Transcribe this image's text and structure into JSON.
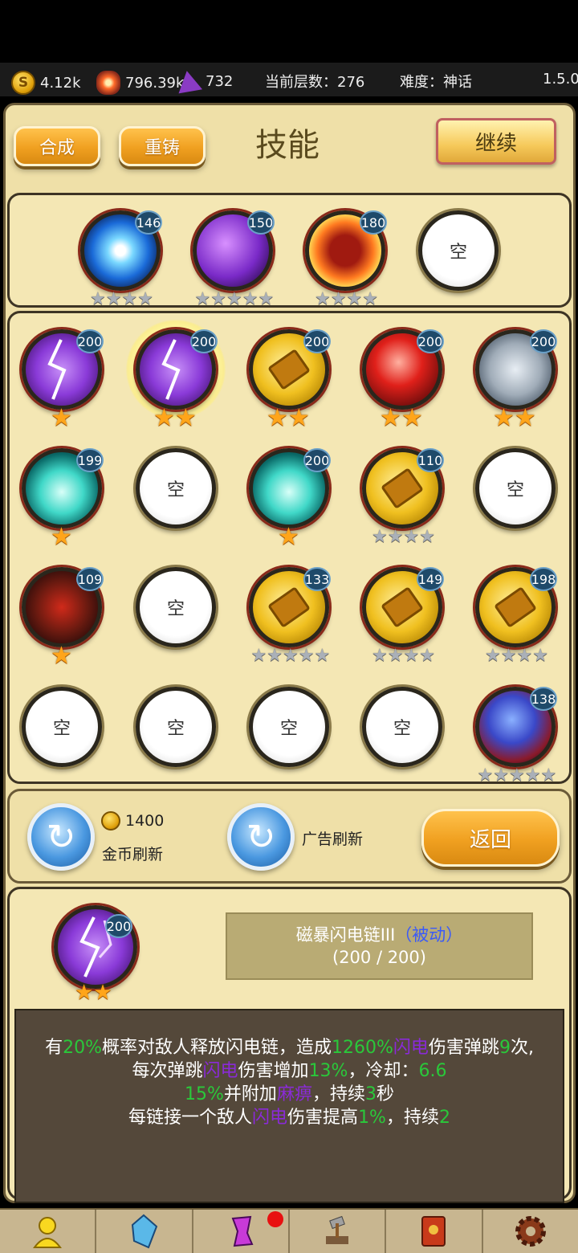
{
  "topbar": {
    "gold": "4.12k",
    "ore": "796.39k",
    "gems": "732",
    "floor": "当前层数：276",
    "difficulty": "难度：神话",
    "version": "1.5.0"
  },
  "header": {
    "craft_label": "合成",
    "reforge_label": "重铸",
    "title": "技能",
    "continue_label": "继续"
  },
  "equipped": [
    {
      "level": "146",
      "stars": 4,
      "skill": "lightning-orb"
    },
    {
      "level": "150",
      "stars": 5,
      "skill": "arcane-bolt"
    },
    {
      "level": "180",
      "stars": 4,
      "skill": "fire-body"
    },
    {
      "empty": "空"
    }
  ],
  "inventory": [
    {
      "level": "200",
      "stars": 1,
      "star_type": "orange",
      "skill": "chain-lightning"
    },
    {
      "level": "200",
      "stars": 2,
      "star_type": "orange",
      "skill": "chain-lightning",
      "selected": true
    },
    {
      "level": "200",
      "stars": 2,
      "star_type": "orange",
      "skill": "gold-brick"
    },
    {
      "level": "200",
      "stars": 2,
      "star_type": "orange",
      "skill": "blood-drop"
    },
    {
      "level": "200",
      "stars": 2,
      "star_type": "orange",
      "skill": "stone-skin"
    },
    {
      "level": "199",
      "stars": 1,
      "star_type": "orange",
      "skill": "ice-spikes"
    },
    {
      "empty": "空"
    },
    {
      "level": "200",
      "stars": 1,
      "star_type": "orange",
      "skill": "ice-spikes"
    },
    {
      "level": "110",
      "stars": 4,
      "star_type": "gray",
      "skill": "gold-brick"
    },
    {
      "empty": "空"
    },
    {
      "level": "109",
      "stars": 1,
      "star_type": "orange",
      "skill": "demon-rune"
    },
    {
      "empty": "空"
    },
    {
      "level": "133",
      "stars": 5,
      "star_type": "gray",
      "skill": "gold-brick"
    },
    {
      "level": "149",
      "stars": 4,
      "star_type": "gray",
      "skill": "gold-brick"
    },
    {
      "level": "198",
      "stars": 4,
      "star_type": "gray",
      "skill": "gold-brick"
    },
    {
      "empty": "空"
    },
    {
      "empty": "空"
    },
    {
      "empty": "空"
    },
    {
      "empty": "空"
    },
    {
      "level": "138",
      "stars": 5,
      "star_type": "gray",
      "skill": "cosmic-storm"
    }
  ],
  "refresh": {
    "gold_cost": "1400",
    "gold_label": "金币刷新",
    "ad_label": "广告刷新",
    "back_label": "返回"
  },
  "detail": {
    "level": "200",
    "stars": 2,
    "name": "磁暴闪电链III",
    "type": "（被动）",
    "progress": "(200 / 200)",
    "desc": {
      "l1": [
        "有",
        "20%",
        "概率对敌人释放闪电链，造成",
        "1260%",
        "闪电",
        "伤害弹跳",
        "9",
        "次,"
      ],
      "l2": [
        "每次弹跳",
        "闪电",
        "伤害增加",
        "13%",
        "，冷却：",
        "6.6"
      ],
      "l3": [
        "15%",
        "并附加",
        "麻痹",
        "，持续",
        "3",
        "秒"
      ],
      "l4": [
        "每链接一个敌人",
        "闪电",
        "伤害提高",
        "1%",
        "，持续",
        "2"
      ]
    }
  },
  "bottom_tabs": [
    "hero-icon",
    "crystal-icon",
    "rune-icon",
    "forge-icon",
    "book-icon",
    "gear-icon"
  ],
  "colors": {
    "accent_orange": "#f0a020",
    "panel": "#efe0a8",
    "value_green": "#2ac83a",
    "element_purple": "#8a2ad8",
    "passive_blue": "#3a5af8"
  }
}
